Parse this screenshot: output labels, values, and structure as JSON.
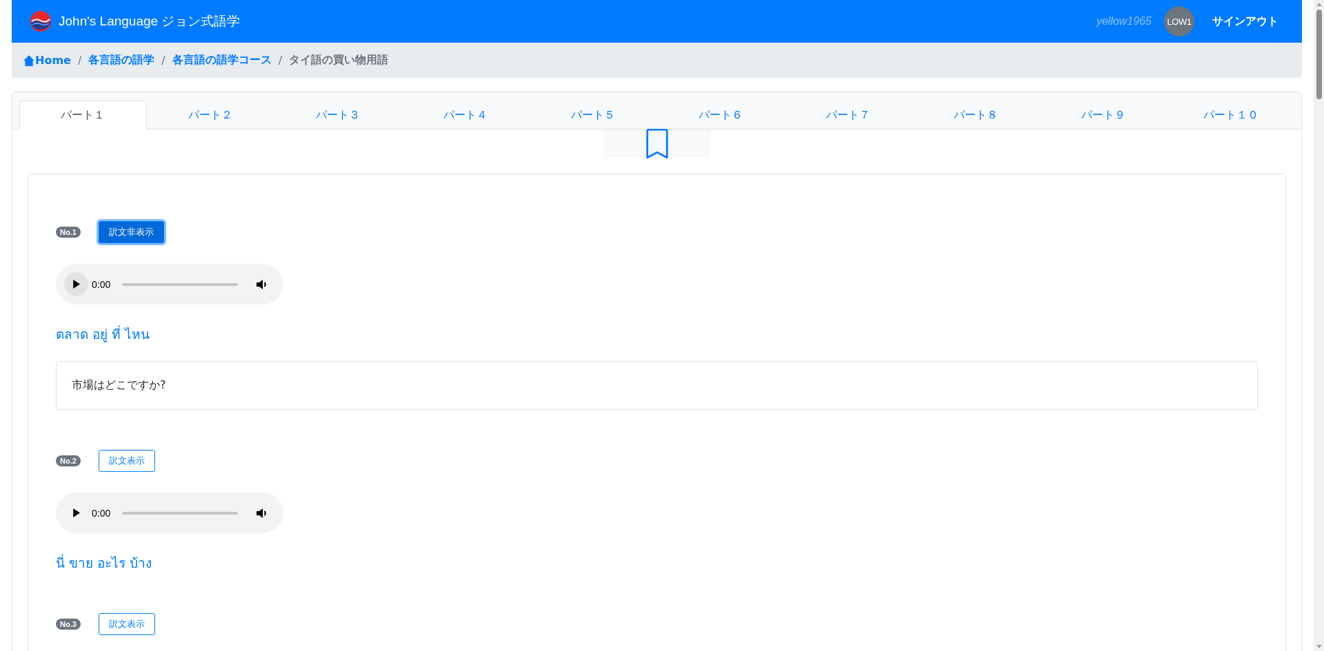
{
  "header": {
    "brand": "John's Language ジョン式語学",
    "username": "yellow1965",
    "avatar": "LOW1",
    "signout": "サインアウト"
  },
  "breadcrumb": {
    "separator": "/",
    "items": [
      {
        "label": "Home",
        "kind": "home",
        "current": false
      },
      {
        "label": "各言語の語学",
        "kind": "link",
        "current": false
      },
      {
        "label": "各言語の語学コース",
        "kind": "link",
        "current": false
      },
      {
        "label": "タイ語の買い物用語",
        "kind": "link",
        "current": true
      }
    ]
  },
  "tabs": [
    {
      "label": "パート１",
      "selected": true
    },
    {
      "label": "パート２",
      "selected": false
    },
    {
      "label": "パート３",
      "selected": false
    },
    {
      "label": "パート４",
      "selected": false
    },
    {
      "label": "パート５",
      "selected": false
    },
    {
      "label": "パート６",
      "selected": false
    },
    {
      "label": "パート７",
      "selected": false
    },
    {
      "label": "パート８",
      "selected": false
    },
    {
      "label": "パート９",
      "selected": false
    },
    {
      "label": "パート１０",
      "selected": false
    }
  ],
  "phrases": [
    {
      "number": "No.1",
      "button": "訳文非表示",
      "translation_shown": true,
      "audio_time": "0:00",
      "thai": "ตลาด อยู่ ที่ ไหน",
      "translation": "市場はどこですか?"
    },
    {
      "number": "No.2",
      "button": "訳文表示",
      "translation_shown": false,
      "audio_time": "0:00",
      "thai": "นี่ ขาย อะไร บ้าง"
    },
    {
      "number": "No.3",
      "button": "訳文表示",
      "translation_shown": false
    }
  ]
}
